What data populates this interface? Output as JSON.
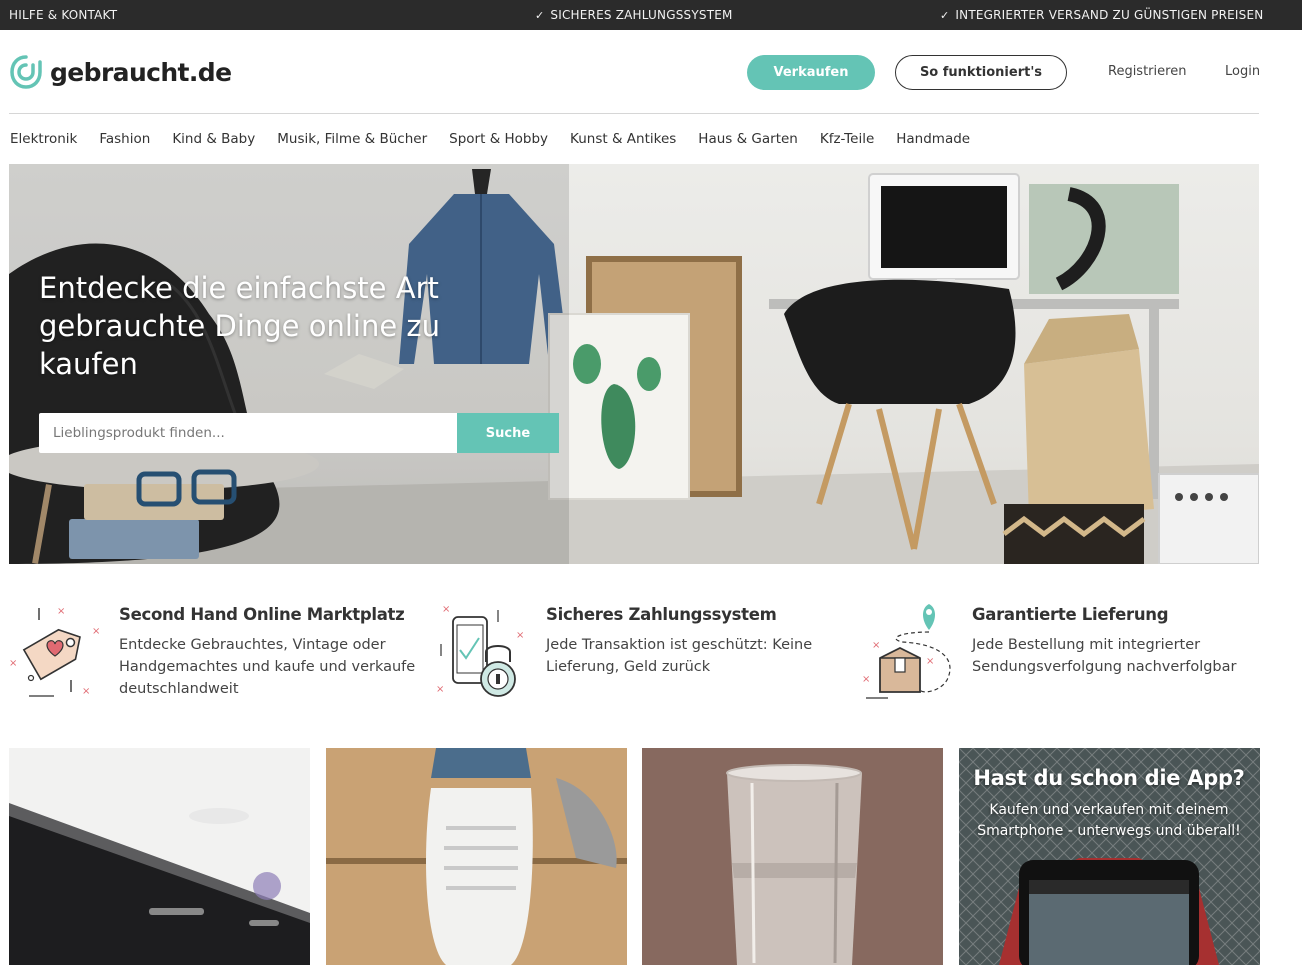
{
  "topbar": {
    "help": "HILFE & KONTAKT",
    "payment": "SICHERES ZAHLUNGSSYSTEM",
    "shipping": "INTEGRIERTER VERSAND ZU GÜNSTIGEN PREISEN"
  },
  "header": {
    "logo_text": "gebraucht.de",
    "sell_button": "Verkaufen",
    "how_button": "So funktioniert's",
    "register": "Registrieren",
    "login": "Login"
  },
  "categories": [
    "Elektronik",
    "Fashion",
    "Kind & Baby",
    "Musik, Filme & Bücher",
    "Sport & Hobby",
    "Kunst & Antikes",
    "Haus & Garten",
    "Kfz-Teile",
    "Handmade"
  ],
  "hero": {
    "title": "Entdecke die einfachste Art gebrauchte Dinge online zu kaufen",
    "search_placeholder": "Lieblingsprodukt finden...",
    "search_button": "Suche"
  },
  "features": [
    {
      "icon": "price-tag-heart-icon",
      "title": "Second Hand Online Marktplatz",
      "description": "Entdecke Gebrauchtes, Vintage oder Handgemachtes und kaufe und verkaufe deutschlandweit"
    },
    {
      "icon": "phone-lock-icon",
      "title": "Sicheres Zahlungssystem",
      "description": "Jede Transaktion ist geschützt: Keine Lieferung, Geld zurück"
    },
    {
      "icon": "package-location-icon",
      "title": "Garantierte Lieferung",
      "description": "Jede Bestellung mit integrierter Sendungsverfolgung nachverfolgbar"
    }
  ],
  "app_promo": {
    "title": "Hast du schon die App?",
    "subtitle": "Kaufen und verkaufen mit deinem Smartphone - unterwegs und überall!"
  },
  "colors": {
    "accent": "#64c4b5",
    "topbar": "#2b2b2b",
    "text": "#333333"
  }
}
